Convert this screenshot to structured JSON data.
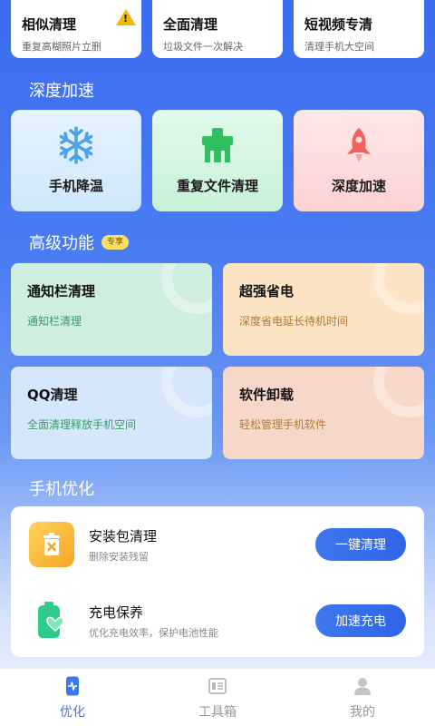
{
  "top_cards": [
    {
      "title": "相似清理",
      "subtitle": "重复高糊照片立删",
      "badge": "!"
    },
    {
      "title": "全面清理",
      "subtitle": "垃圾文件一次解决"
    },
    {
      "title": "短视频专清",
      "subtitle": "清理手机大空间"
    }
  ],
  "sections": {
    "deep": "深度加速",
    "advanced": "高级功能",
    "advanced_badge": "专享",
    "optimize": "手机优化"
  },
  "deep_cards": [
    {
      "label": "手机降温",
      "icon": "snowflake-icon"
    },
    {
      "label": "重复文件清理",
      "icon": "duplicate-file-icon"
    },
    {
      "label": "深度加速",
      "icon": "rocket-icon"
    }
  ],
  "advanced_cards": [
    {
      "title": "通知栏清理",
      "subtitle": "通知栏清理"
    },
    {
      "title": "超强省电",
      "subtitle": "深度省电延长待机时间"
    },
    {
      "title": "QQ清理",
      "subtitle": "全面清理释放手机空间"
    },
    {
      "title": "软件卸载",
      "subtitle": "轻松管理手机软件"
    }
  ],
  "optimize": [
    {
      "title": "安装包清理",
      "subtitle": "删除安装残留",
      "button": "一键清理",
      "icon": "trash-bin-icon"
    },
    {
      "title": "充电保养",
      "subtitle": "优化充电效率，保护电池性能",
      "button": "加速充电",
      "icon": "battery-heart-icon"
    }
  ],
  "tabs": [
    {
      "label": "优化",
      "icon": "phone-pulse-icon",
      "active": true
    },
    {
      "label": "工具箱",
      "icon": "toolbox-icon"
    },
    {
      "label": "我的",
      "icon": "user-icon"
    }
  ],
  "colors": {
    "accent": "#3e78f0"
  }
}
